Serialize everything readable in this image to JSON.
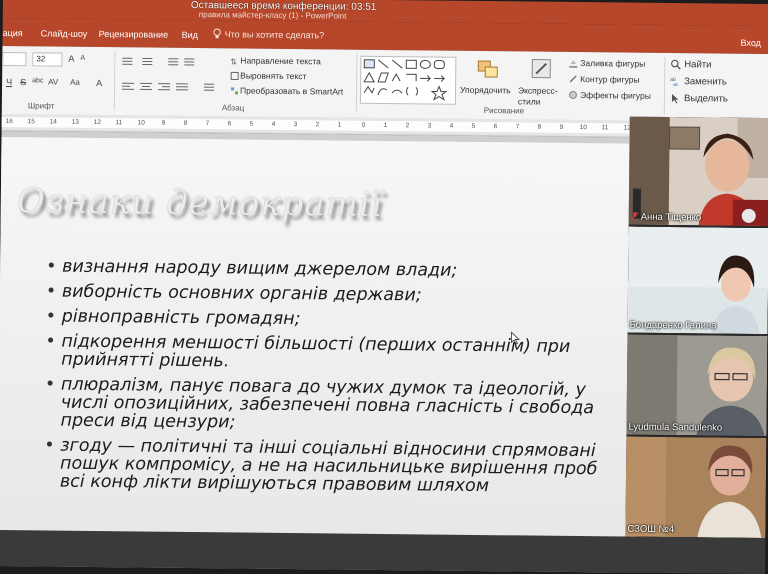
{
  "window": {
    "conference_timer": "Оставшееся время конференции: 03:51",
    "doc_title": "правила майстер-класу (1) - PowerPoint"
  },
  "ribbon_tabs": {
    "items": [
      "ация",
      "Слайд-шоу",
      "Рецензирование",
      "Вид"
    ],
    "tell_me": "Что вы хотите сделать?",
    "signin": "Вход"
  },
  "ribbon": {
    "font_size": "32",
    "font_group_label": "Шрифт",
    "font_buttons": [
      "A",
      "A",
      "Ч",
      "S",
      "abc",
      "AV",
      "Aa",
      "A"
    ],
    "paragraph": {
      "label": "Абзац",
      "text_direction": "Направление текста",
      "align_text": "Выровнять текст",
      "convert_smartart": "Преобразовать в SmartArt"
    },
    "drawing": {
      "label": "Рисование",
      "arrange": "Упорядочить",
      "quick_styles": "Экспресс-стили",
      "shape_fill": "Заливка фигуры",
      "shape_outline": "Контур фигуры",
      "shape_effects": "Эффекты фигуры"
    },
    "editing": {
      "find": "Найти",
      "replace": "Заменить",
      "select": "Выделить"
    },
    "icons": [
      "shape-fill-icon",
      "shape-outline-icon",
      "shape-effects-icon",
      "find-icon",
      "replace-icon",
      "select-icon",
      "arrange-icon",
      "quick-styles-icon"
    ]
  },
  "ruler": {
    "left_ticks": [
      "16",
      "15",
      "14",
      "13",
      "12",
      "11",
      "10",
      "9",
      "8",
      "7",
      "6",
      "5",
      "4",
      "3",
      "2",
      "1",
      "0"
    ],
    "right_ticks": [
      "1",
      "2",
      "3",
      "4",
      "5",
      "6",
      "7",
      "8",
      "9",
      "10",
      "11",
      "12"
    ]
  },
  "slide": {
    "title": "Ознаки демократії",
    "bullets": [
      {
        "lines": [
          "визнання народу вищим джерелом влади;"
        ]
      },
      {
        "lines": [
          "виборність основних органів держави;"
        ]
      },
      {
        "lines": [
          "рівноправність громадян;"
        ]
      },
      {
        "lines": [
          "підкорення меншості більшості (перших останнім) при",
          "прийнятті рішень."
        ]
      },
      {
        "lines": [
          "плюралізм, панує повага до чужих думок та ідеологій, у",
          "числі опозиційних, забезпечені повна гласність і свобода",
          "преси від цензури;"
        ]
      },
      {
        "lines": [
          "згоду — політичні та інші соціальні відносини спрямовані",
          "пошук компромісу, а не на насильницьке вирішення проб",
          "всі конф лікти вирішуються правовим шляхом"
        ]
      }
    ]
  },
  "participants": [
    {
      "name": "Анна Тіщенко",
      "muted": true
    },
    {
      "name": "Бондаренко Галина",
      "muted": false
    },
    {
      "name": "Lyudmula Sandulenko",
      "muted": false
    },
    {
      "name": "СЗОШ №4",
      "muted": false
    }
  ],
  "colors": {
    "ppt_accent": "#b7472a",
    "ribbon_bg": "#f4f4f4",
    "mic_off": "#e53935"
  }
}
